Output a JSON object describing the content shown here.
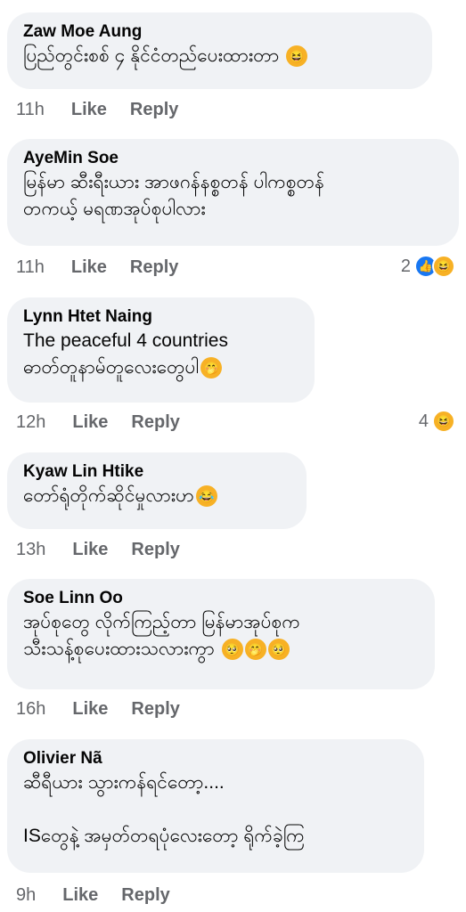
{
  "comments": [
    {
      "author": "Zaw Moe Aung",
      "text": "ပြည်တွင်းစစ် ၄ နိုင်ငံတည်ပေးထားတာ",
      "emojis": [
        "😆"
      ],
      "time": "11h",
      "like": "Like",
      "reply": "Reply"
    },
    {
      "author": "AyeMin Soe",
      "text": "မြန်မာ ဆီးရီးယား အာဖဂန်နစ္စတန် ပါကစ္စတန်\nတကယ့် မရဏအုပ်စုပါလား",
      "emojis": [],
      "time": "11h",
      "like": "Like",
      "reply": "Reply",
      "reaction_count": "2",
      "reactions": [
        "like-icon",
        "haha-icon"
      ]
    },
    {
      "author": "Lynn Htet Naing",
      "text": "The peaceful 4 countries\nဓာတ်တူနာမ်တူလေးတွေပါ",
      "emojis": [
        "🤭"
      ],
      "time": "12h",
      "like": "Like",
      "reply": "Reply",
      "reaction_count": "4",
      "reactions": [
        "haha-icon"
      ]
    },
    {
      "author": "Kyaw Lin Htike",
      "text": "တော်ရုံတိုက်ဆိုင်မှုလားဟ",
      "emojis": [
        "😂"
      ],
      "time": "13h",
      "like": "Like",
      "reply": "Reply"
    },
    {
      "author": "Soe Linn Oo",
      "text": "အုပ်စုတွေ လိုက်ကြည့်တာ မြန်မာအုပ်စုက\nသီးသန့်စုပေးထားသလားကွာ",
      "emojis": [
        "🥺",
        "🤭",
        "🥺"
      ],
      "time": "16h",
      "like": "Like",
      "reply": "Reply"
    },
    {
      "author": "Olivier Nã",
      "text": "ဆီရီယား သွားကန်ရင်တော့....\n\nISတွေနဲ့ အမှတ်တရပုံလေးတော့ ရိုက်ခဲ့ကြ",
      "emojis": [],
      "time": "9h",
      "like": "Like",
      "reply": "Reply"
    }
  ]
}
